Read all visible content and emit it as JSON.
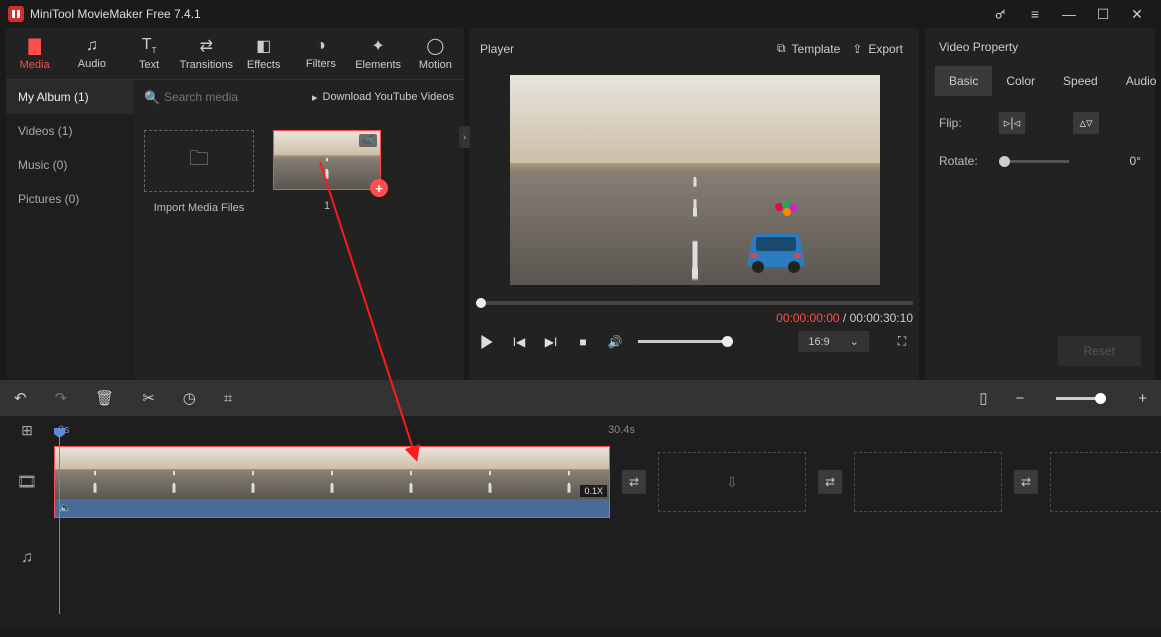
{
  "app": {
    "title": "MiniTool MovieMaker Free 7.4.1"
  },
  "toptabs": [
    {
      "label": "Media"
    },
    {
      "label": "Audio"
    },
    {
      "label": "Text"
    },
    {
      "label": "Transitions"
    },
    {
      "label": "Effects"
    },
    {
      "label": "Filters"
    },
    {
      "label": "Elements"
    },
    {
      "label": "Motion"
    }
  ],
  "sidenav": [
    {
      "label": "My Album (1)"
    },
    {
      "label": "Videos (1)"
    },
    {
      "label": "Music (0)"
    },
    {
      "label": "Pictures (0)"
    }
  ],
  "media": {
    "search_placeholder": "Search media",
    "download_label": "Download YouTube Videos",
    "import_label": "Import Media Files",
    "clip_caption": "1"
  },
  "player": {
    "title": "Player",
    "template_label": "Template",
    "export_label": "Export",
    "time_current": "00:00:00:00",
    "time_sep": " / ",
    "time_total": "00:00:30:10",
    "aspect_label": "16:9"
  },
  "props": {
    "title": "Video Property",
    "tabs": [
      {
        "label": "Basic"
      },
      {
        "label": "Color"
      },
      {
        "label": "Speed"
      },
      {
        "label": "Audio"
      }
    ],
    "flip_label": "Flip:",
    "rotate_label": "Rotate:",
    "rotate_value": "0°",
    "reset_label": "Reset"
  },
  "timeline": {
    "ruler": {
      "t0": "0s",
      "t1": "30.4s"
    },
    "speed_badge": "0.1X"
  }
}
